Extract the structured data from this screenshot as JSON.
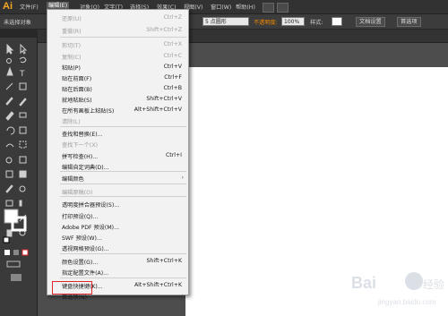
{
  "app": {
    "logo": "Ai",
    "menus": [
      "文件(F)",
      "编辑(E)",
      "对象(O)",
      "文字(T)",
      "选择(S)",
      "效果(C)",
      "视图(V)",
      "窗口(W)",
      "帮助(H)"
    ],
    "active_menu": "编辑(E)"
  },
  "control_bar": {
    "selection": "未选择对象",
    "stroke_size": "5 点圆形",
    "opacity_label": "不透明度:",
    "opacity_value": "100%",
    "style_label": "样式:",
    "doc_settings": "文档设置",
    "preferences": "首选项"
  },
  "edit_menu": {
    "items": [
      {
        "label": "还原(U)",
        "shortcut": "Ctrl+Z",
        "disabled": true
      },
      {
        "label": "重做(R)",
        "shortcut": "Shift+Ctrl+Z",
        "disabled": true
      },
      {
        "label": "剪切(T)",
        "shortcut": "Ctrl+X",
        "disabled": true
      },
      {
        "label": "复制(C)",
        "shortcut": "Ctrl+C",
        "disabled": true
      },
      {
        "label": "粘贴(P)",
        "shortcut": "Ctrl+V",
        "disabled": false
      },
      {
        "label": "贴在前面(F)",
        "shortcut": "Ctrl+F",
        "disabled": false
      },
      {
        "label": "贴在后面(B)",
        "shortcut": "Ctrl+B",
        "disabled": false
      },
      {
        "label": "就地粘贴(S)",
        "shortcut": "Shift+Ctrl+V",
        "disabled": false
      },
      {
        "label": "在所有画板上粘贴(S)",
        "shortcut": "Alt+Shift+Ctrl+V",
        "disabled": false
      },
      {
        "label": "清除(L)",
        "shortcut": "",
        "disabled": true
      },
      {
        "label": "查找和替换(E)...",
        "shortcut": "",
        "disabled": false
      },
      {
        "label": "查找下一个(X)",
        "shortcut": "",
        "disabled": true
      },
      {
        "label": "拼写检查(H)...",
        "shortcut": "Ctrl+I",
        "disabled": false
      },
      {
        "label": "编辑自定词典(D)...",
        "shortcut": "",
        "disabled": false
      },
      {
        "label": "编辑颜色",
        "shortcut": "",
        "disabled": false,
        "submenu": true
      },
      {
        "label": "编辑原稿(O)",
        "shortcut": "",
        "disabled": true
      },
      {
        "label": "透明度拼合器预设(S)...",
        "shortcut": "",
        "disabled": false
      },
      {
        "label": "打印预设(Q)...",
        "shortcut": "",
        "disabled": false
      },
      {
        "label": "Adobe PDF 预设(M)...",
        "shortcut": "",
        "disabled": false
      },
      {
        "label": "SWF 预设(W)...",
        "shortcut": "",
        "disabled": false
      },
      {
        "label": "透视网格预设(G)...",
        "shortcut": "",
        "disabled": false
      },
      {
        "label": "颜色设置(G)...",
        "shortcut": "Shift+Ctrl+K",
        "disabled": false
      },
      {
        "label": "指定配置文件(A)...",
        "shortcut": "",
        "disabled": false
      },
      {
        "label": "键盘快捷键(K)...",
        "shortcut": "Alt+Shift+Ctrl+K",
        "disabled": false
      },
      {
        "label": "首选项(N)",
        "shortcut": "",
        "disabled": false,
        "submenu": true
      }
    ],
    "arrow_glyph": "›"
  },
  "watermark": {
    "brand": "Bai",
    "brand2": "经验",
    "url": "jingyan.baidu.com"
  },
  "colors": {
    "highlight_box": "#e1252a",
    "logo": "#f5a623",
    "opacity_warning": "#f08a00"
  }
}
